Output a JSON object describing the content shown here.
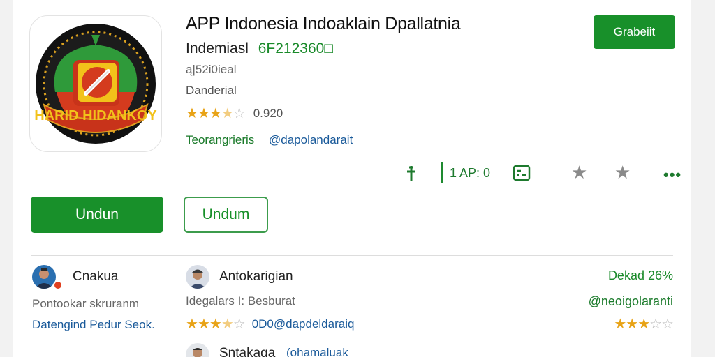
{
  "app": {
    "title": "APP Indonesia Indoaklain Dpallatnia",
    "developer": "Indemiasl",
    "code": "6F212360□",
    "meta_line1": "ą|52i0ieal",
    "meta_line2": "Danderial",
    "rating_value": "0.920",
    "rating_stars": 3.5,
    "tag_category": "Teorangrieris",
    "tag_handle": "@dapolandarait",
    "icon_ring_text": "HARID HIDANKOY"
  },
  "header_button": {
    "label": "Grabeiit"
  },
  "action_row": {
    "sizes_text": "1 AP: 0",
    "icons": [
      "pin-icon",
      "grid-icon",
      "star-icon",
      "star-icon",
      "more-icon"
    ]
  },
  "buttons": {
    "primary_label": "Undun",
    "secondary_label": "Undum"
  },
  "reviews": [
    {
      "name": "Cnakua",
      "subtitle": "Pontookar skruranm",
      "link": "Datengind Pedur Seok."
    },
    {
      "name": "Antokarigian",
      "subtitle": "Idegalars I: Besburat",
      "stars": 3.5,
      "handle": "0D0@dapdeldaraiq"
    },
    {
      "name": "Sntakaga",
      "handle": "(ohamaluak"
    }
  ],
  "right_summary": {
    "percent_label": "Dekad 26%",
    "handle": "@neoigolaranti",
    "stars": 3
  },
  "colors": {
    "brand_green": "#18902a",
    "link_blue": "#1a5a9a",
    "star_gold": "#e8a317"
  }
}
